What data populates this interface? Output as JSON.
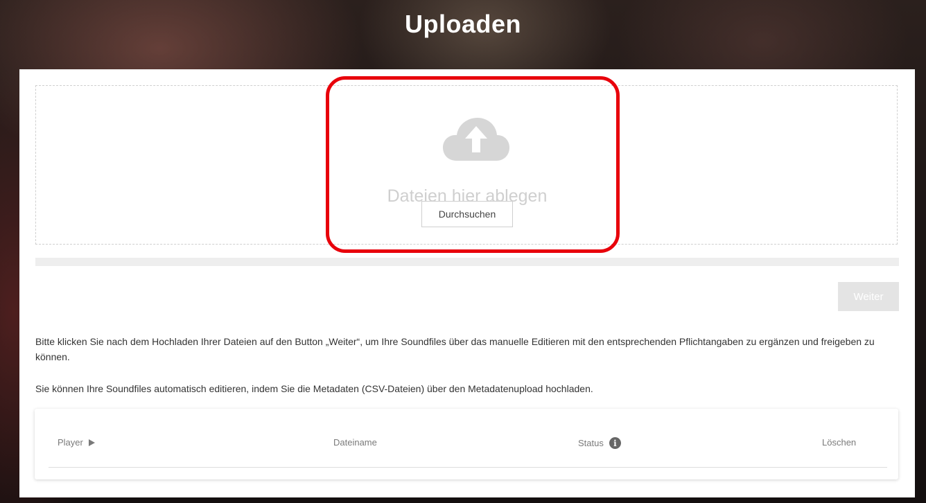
{
  "page": {
    "title": "Uploaden"
  },
  "dropzone": {
    "icon": "cloud-upload-icon",
    "drop_text": "Dateien hier ablegen",
    "browse_label": "Durchsuchen"
  },
  "progress": {
    "value_percent": 0
  },
  "actions": {
    "next_label": "Weiter"
  },
  "info": {
    "line1": "Bitte klicken Sie nach dem Hochladen Ihrer Dateien auf den Button „Weiter“, um Ihre Soundfiles über das manuelle Editieren mit den entsprechenden Pflichtangaben zu ergänzen und freigeben zu können.",
    "line2": "Sie können Ihre Soundfiles automatisch editieren, indem Sie die Metadaten (CSV-Dateien) über den Metadatenupload hochladen."
  },
  "table": {
    "columns": {
      "player": "Player",
      "filename": "Dateiname",
      "status": "Status",
      "delete": "Löschen"
    },
    "status_info_icon": "i",
    "rows": []
  },
  "colors": {
    "highlight": "#e8000b",
    "panel": "#ffffff",
    "muted_text": "#cfcfcf"
  }
}
